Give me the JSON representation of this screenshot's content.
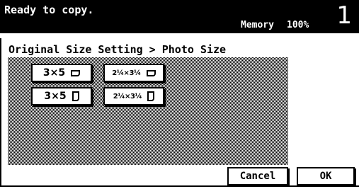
{
  "header": {
    "status": "Ready to copy.",
    "memory_label": "Memory",
    "memory_value": "100%",
    "copies": "1"
  },
  "breadcrumb": "Original Size Setting > Photo Size",
  "sizes": [
    {
      "label": "3×5",
      "orientation": "landscape-icon"
    },
    {
      "label": "2¼×3¼",
      "orientation": "landscape-icon"
    },
    {
      "label": "3×5",
      "orientation": "portrait-icon"
    },
    {
      "label": "2¼×3¼",
      "orientation": "portrait-icon"
    }
  ],
  "actions": {
    "cancel": "Cancel",
    "ok": "OK"
  }
}
